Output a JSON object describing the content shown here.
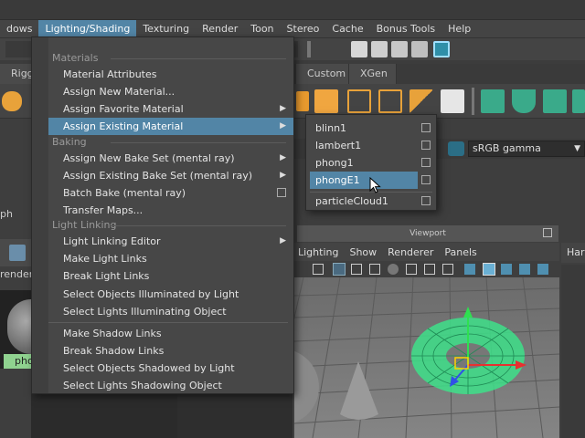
{
  "menubar": {
    "items": [
      "dows",
      "Lighting/Shading",
      "Texturing",
      "Render",
      "Toon",
      "Stereo",
      "Cache",
      "Bonus Tools",
      "Help"
    ],
    "active": "Lighting/Shading"
  },
  "shelf_tabs": [
    "Rigg",
    "Custom",
    "XGen"
  ],
  "color_space": {
    "label": "sRGB gamma"
  },
  "left_panel": {
    "graph_label": "ph",
    "rendering_label": "renderin",
    "swatch_label": "pho"
  },
  "dropdown": {
    "sections": {
      "materials": "Materials",
      "baking": "Baking",
      "light_linking": "Light Linking"
    },
    "items": {
      "material_attributes": "Material Attributes",
      "assign_new_material": "Assign New Material...",
      "assign_favorite_material": "Assign Favorite Material",
      "assign_existing_material": "Assign Existing Material",
      "assign_new_bake_set": "Assign New Bake Set (mental ray)",
      "assign_existing_bake_set": "Assign Existing Bake Set (mental ray)",
      "batch_bake": "Batch Bake (mental ray)",
      "transfer_maps": "Transfer Maps...",
      "light_linking_editor": "Light Linking Editor",
      "make_light_links": "Make Light Links",
      "break_light_links": "Break Light Links",
      "select_objects_illuminated": "Select Objects Illuminated by Light",
      "select_lights_illuminating": "Select Lights Illuminating Object",
      "make_shadow_links": "Make Shadow Links",
      "break_shadow_links": "Break Shadow Links",
      "select_objects_shadowed": "Select Objects Shadowed by Light",
      "select_lights_shadowing": "Select Lights Shadowing Object"
    }
  },
  "submenu": {
    "items": [
      "blinn1",
      "lambert1",
      "phong1",
      "phongE1",
      "particleCloud1"
    ],
    "highlighted": "phongE1"
  },
  "viewport": {
    "title": "Viewport",
    "menu": [
      "Lighting",
      "Show",
      "Renderer",
      "Panels"
    ]
  },
  "right_panel": {
    "label": "Har"
  },
  "colors": {
    "accent": "#5285a6",
    "menu_bg": "#474747",
    "wireframe": "#3ee08a"
  }
}
